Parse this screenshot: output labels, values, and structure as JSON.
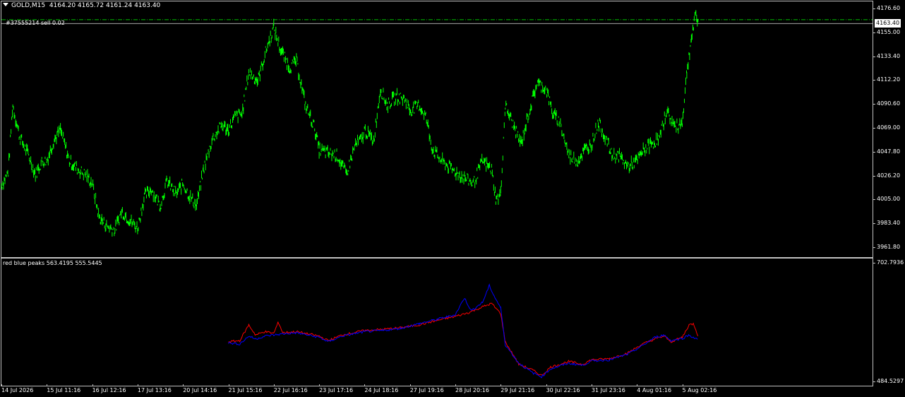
{
  "header": {
    "symbol": "GOLD,M15",
    "ohlc": "4164.20 4165.72 4161.24 4163.40",
    "order_label": "#37555214 sell 0.02"
  },
  "colors": {
    "candles": "#00ff00",
    "bid_line": "#c0c0c0",
    "order_line": "#00c000",
    "red_series": "#ff0000",
    "blue_series": "#0000ff",
    "frame": "#c0c0c0"
  },
  "price_axis": {
    "ticks": [
      "4176.60",
      "4155.00",
      "4133.40",
      "4112.20",
      "4090.60",
      "4069.00",
      "4047.80",
      "4026.20",
      "4005.00",
      "3983.40",
      "3961.80"
    ],
    "current_price": "4163.40"
  },
  "indicator": {
    "title": "red blue peaks 563.4195 555.5445",
    "axis_max": "702.7936",
    "axis_min": "484.5297"
  },
  "time_axis": {
    "ticks": [
      "14 Jul 2026",
      "15 Jul 11:16",
      "16 Jul 12:16",
      "17 Jul 13:16",
      "20 Jul 14:16",
      "21 Jul 15:16",
      "22 Jul 16:16",
      "23 Jul 17:16",
      "24 Jul 18:16",
      "27 Jul 19:16",
      "28 Jul 20:16",
      "29 Jul 21:16",
      "30 Jul 22:16",
      "31 Jul 23:16",
      "4 Aug 01:16",
      "5 Aug 02:16"
    ]
  },
  "chart_data": [
    {
      "type": "line",
      "title": "GOLD,M15",
      "ylim": [
        3955,
        4182
      ],
      "x": [
        "14 Jul 2026",
        "15 Jul 11:16",
        "16 Jul 12:16",
        "17 Jul 13:16",
        "20 Jul 14:16",
        "21 Jul 15:16",
        "22 Jul 16:16",
        "23 Jul 17:16",
        "24 Jul 18:16",
        "27 Jul 19:16",
        "28 Jul 20:16",
        "29 Jul 21:16",
        "30 Jul 22:16",
        "31 Jul 23:16",
        "4 Aug 01:16",
        "5 Aug 02:16"
      ],
      "series": [
        {
          "points": [
            [
              0,
              4018
            ],
            [
              0.15,
              4030
            ],
            [
              0.25,
              4090
            ],
            [
              0.4,
              4062
            ],
            [
              0.6,
              4045
            ],
            [
              0.75,
              4028
            ],
            [
              0.9,
              4040
            ],
            [
              1.0,
              4040
            ],
            [
              1.15,
              4058
            ],
            [
              1.3,
              4068
            ],
            [
              1.5,
              4040
            ],
            [
              1.7,
              4032
            ],
            [
              1.85,
              4028
            ],
            [
              2.0,
              4020
            ],
            [
              2.15,
              3990
            ],
            [
              2.3,
              3982
            ],
            [
              2.5,
              3978
            ],
            [
              2.65,
              3995
            ],
            [
              2.8,
              3988
            ],
            [
              3.0,
              3980
            ],
            [
              3.15,
              4008
            ],
            [
              3.3,
              4015
            ],
            [
              3.5,
              4000
            ],
            [
              3.65,
              4022
            ],
            [
              3.85,
              4010
            ],
            [
              4.0,
              4020
            ],
            [
              4.15,
              4008
            ],
            [
              4.3,
              4000
            ],
            [
              4.45,
              4032
            ],
            [
              4.65,
              4060
            ],
            [
              4.85,
              4072
            ],
            [
              5.0,
              4068
            ],
            [
              5.15,
              4080
            ],
            [
              5.3,
              4082
            ],
            [
              5.45,
              4120
            ],
            [
              5.65,
              4112
            ],
            [
              5.85,
              4142
            ],
            [
              6.0,
              4160
            ],
            [
              6.15,
              4140
            ],
            [
              6.35,
              4124
            ],
            [
              6.5,
              4130
            ],
            [
              6.7,
              4090
            ],
            [
              6.9,
              4070
            ],
            [
              7.0,
              4050
            ],
            [
              7.2,
              4047
            ],
            [
              7.4,
              4045
            ],
            [
              7.6,
              4028
            ],
            [
              7.8,
              4055
            ],
            [
              7.95,
              4060
            ],
            [
              8.0,
              4068
            ],
            [
              8.2,
              4058
            ],
            [
              8.35,
              4105
            ],
            [
              8.5,
              4090
            ],
            [
              8.7,
              4098
            ],
            [
              8.9,
              4095
            ],
            [
              9.0,
              4085
            ],
            [
              9.2,
              4090
            ],
            [
              9.35,
              4080
            ],
            [
              9.5,
              4050
            ],
            [
              9.7,
              4040
            ],
            [
              9.85,
              4035
            ],
            [
              10.0,
              4030
            ],
            [
              10.2,
              4025
            ],
            [
              10.4,
              4020
            ],
            [
              10.6,
              4040
            ],
            [
              10.8,
              4032
            ],
            [
              10.9,
              4005
            ],
            [
              11.0,
              4010
            ],
            [
              11.1,
              4090
            ],
            [
              11.3,
              4070
            ],
            [
              11.45,
              4055
            ],
            [
              11.6,
              4080
            ],
            [
              11.8,
              4110
            ],
            [
              12.0,
              4105
            ],
            [
              12.15,
              4082
            ],
            [
              12.3,
              4075
            ],
            [
              12.5,
              4045
            ],
            [
              12.7,
              4040
            ],
            [
              12.85,
              4050
            ],
            [
              13.0,
              4055
            ],
            [
              13.15,
              4075
            ],
            [
              13.3,
              4062
            ],
            [
              13.45,
              4045
            ],
            [
              13.6,
              4045
            ],
            [
              13.8,
              4035
            ],
            [
              14.0,
              4040
            ],
            [
              14.15,
              4050
            ],
            [
              14.3,
              4055
            ],
            [
              14.5,
              4060
            ],
            [
              14.65,
              4085
            ],
            [
              14.85,
              4070
            ],
            [
              15.0,
              4075
            ],
            [
              15.1,
              4120
            ],
            [
              15.2,
              4150
            ],
            [
              15.3,
              4172
            ],
            [
              15.35,
              4163
            ]
          ]
        }
      ]
    },
    {
      "type": "line",
      "title": "red blue peaks 563.4195 555.5445",
      "ylim": [
        484.5297,
        702.7936
      ],
      "x": [
        "14 Jul 2026",
        "15 Jul 11:16",
        "16 Jul 12:16",
        "17 Jul 13:16",
        "20 Jul 14:16",
        "21 Jul 15:16",
        "22 Jul 16:16",
        "23 Jul 17:16",
        "24 Jul 18:16",
        "27 Jul 19:16",
        "28 Jul 20:16",
        "29 Jul 21:16",
        "30 Jul 22:16",
        "31 Jul 23:16",
        "4 Aug 01:16",
        "5 Aug 02:16"
      ],
      "series": [
        {
          "color": "red",
          "points": [
            [
              5.0,
              560
            ],
            [
              5.25,
              562
            ],
            [
              5.45,
              590
            ],
            [
              5.6,
              572
            ],
            [
              5.8,
              578
            ],
            [
              6.0,
              575
            ],
            [
              6.1,
              595
            ],
            [
              6.2,
              576
            ],
            [
              6.5,
              578
            ],
            [
              7.0,
              570
            ],
            [
              7.2,
              562
            ],
            [
              7.5,
              572
            ],
            [
              8.0,
              580
            ],
            [
              8.4,
              582
            ],
            [
              8.8,
              585
            ],
            [
              9.2,
              590
            ],
            [
              9.6,
              598
            ],
            [
              10.0,
              605
            ],
            [
              10.3,
              612
            ],
            [
              10.6,
              622
            ],
            [
              10.8,
              628
            ],
            [
              11.0,
              610
            ],
            [
              11.1,
              560
            ],
            [
              11.4,
              520
            ],
            [
              11.7,
              510
            ],
            [
              11.9,
              500
            ],
            [
              12.1,
              515
            ],
            [
              12.5,
              525
            ],
            [
              12.8,
              520
            ],
            [
              13.0,
              528
            ],
            [
              13.4,
              530
            ],
            [
              13.8,
              540
            ],
            [
              14.1,
              555
            ],
            [
              14.4,
              565
            ],
            [
              14.6,
              570
            ],
            [
              14.75,
              560
            ],
            [
              15.0,
              568
            ],
            [
              15.15,
              590
            ],
            [
              15.25,
              592
            ],
            [
              15.35,
              570
            ]
          ]
        },
        {
          "color": "blue",
          "points": [
            [
              5.0,
              558
            ],
            [
              5.25,
              556
            ],
            [
              5.45,
              570
            ],
            [
              5.6,
              565
            ],
            [
              5.8,
              570
            ],
            [
              6.0,
              572
            ],
            [
              6.2,
              574
            ],
            [
              6.5,
              576
            ],
            [
              7.0,
              568
            ],
            [
              7.2,
              560
            ],
            [
              7.5,
              570
            ],
            [
              8.0,
              578
            ],
            [
              8.4,
              580
            ],
            [
              8.8,
              584
            ],
            [
              9.2,
              592
            ],
            [
              9.6,
              600
            ],
            [
              10.0,
              608
            ],
            [
              10.2,
              638
            ],
            [
              10.35,
              615
            ],
            [
              10.6,
              630
            ],
            [
              10.75,
              660
            ],
            [
              10.85,
              642
            ],
            [
              11.0,
              620
            ],
            [
              11.1,
              555
            ],
            [
              11.4,
              522
            ],
            [
              11.7,
              505
            ],
            [
              11.9,
              498
            ],
            [
              12.1,
              512
            ],
            [
              12.5,
              522
            ],
            [
              12.8,
              518
            ],
            [
              13.0,
              526
            ],
            [
              13.4,
              528
            ],
            [
              13.8,
              538
            ],
            [
              14.1,
              552
            ],
            [
              14.4,
              568
            ],
            [
              14.6,
              572
            ],
            [
              14.75,
              562
            ],
            [
              15.0,
              566
            ],
            [
              15.15,
              572
            ],
            [
              15.35,
              563
            ]
          ]
        }
      ]
    }
  ]
}
